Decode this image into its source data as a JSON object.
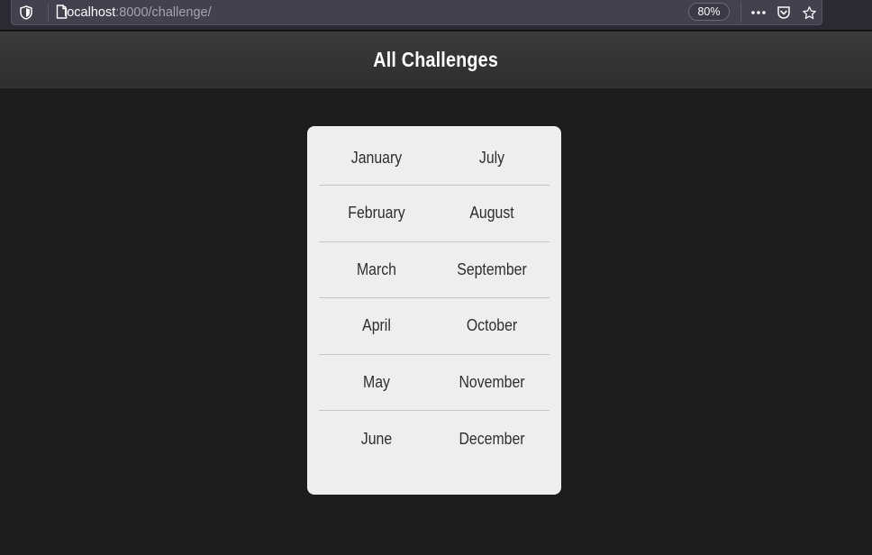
{
  "browser": {
    "url_host": "localhost",
    "url_rest": ":8000/challenge/",
    "zoom": "80%"
  },
  "header": {
    "title": "All Challenges"
  },
  "months": {
    "rows": [
      {
        "left": "January",
        "right": "July"
      },
      {
        "left": "February",
        "right": "August"
      },
      {
        "left": "March",
        "right": "September"
      },
      {
        "left": "April",
        "right": "October"
      },
      {
        "left": "May",
        "right": "November"
      },
      {
        "left": "June",
        "right": "December"
      }
    ]
  },
  "colors": {
    "page_bg": "#1c1c1c",
    "header_bg": "#333333",
    "card_bg": "#eeeeee",
    "text": "#2e2e2e"
  }
}
